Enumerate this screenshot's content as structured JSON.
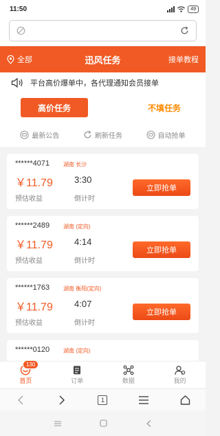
{
  "status_bar": {
    "time": "11:50",
    "battery": "49"
  },
  "header": {
    "location": "全部",
    "title": "迅风任务",
    "tutorial": "接单教程"
  },
  "notice": {
    "text": "平台高价爆单中，各代理通知会员接单"
  },
  "tabs": {
    "active": "高价任务",
    "inactive": "不填任务"
  },
  "actions": [
    {
      "label": "最新公告",
      "icon": "chat-icon"
    },
    {
      "label": "刷新任务",
      "icon": "refresh-icon"
    },
    {
      "label": "自动抢单",
      "icon": "auto-grab-icon"
    }
  ],
  "cards": [
    {
      "order_id": "******4071",
      "region": "湖南 长沙",
      "price": "￥11.79",
      "est_label": "预估收益",
      "time": "3:30",
      "cd_label": "倒计时",
      "button": "立即抢单"
    },
    {
      "order_id": "******2489",
      "region": "湖南 (定向)",
      "price": "￥11.79",
      "est_label": "预估收益",
      "time": "4:14",
      "cd_label": "倒计时",
      "button": "立即抢单"
    },
    {
      "order_id": "******1763",
      "region": "湖南 衡阳(定向)",
      "price": "￥11.79",
      "est_label": "预估收益",
      "time": "4:07",
      "cd_label": "倒计时",
      "button": "立即抢单"
    },
    {
      "order_id": "******0120",
      "region": "湖南 (定向)",
      "price": "",
      "est_label": "",
      "time": "",
      "cd_label": "",
      "button": ""
    }
  ],
  "tabbar": {
    "items": [
      {
        "label": "首页",
        "icon": "home-icon"
      },
      {
        "label": "订单",
        "icon": "order-icon"
      },
      {
        "label": "数据",
        "icon": "data-icon"
      },
      {
        "label": "我的",
        "icon": "profile-icon"
      }
    ],
    "badge": "130"
  },
  "browser": {
    "page_count": "1"
  },
  "colors": {
    "accent": "#f15a24",
    "orange_text": "#ff8a00"
  }
}
